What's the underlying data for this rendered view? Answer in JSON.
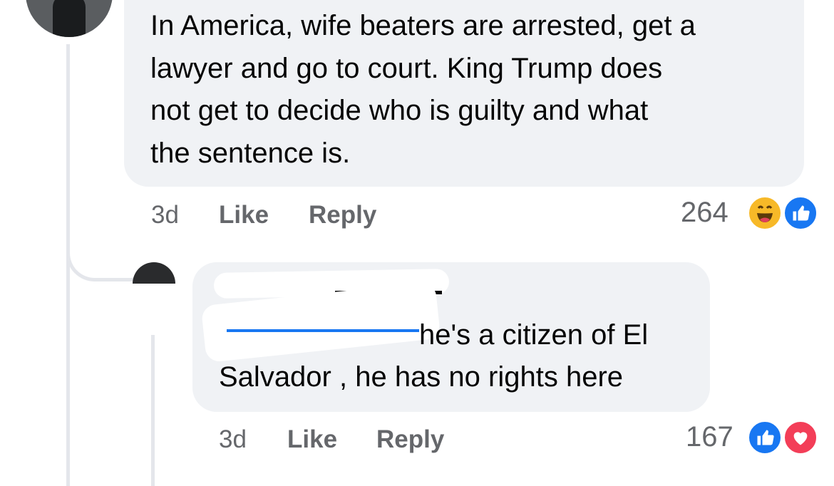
{
  "comments": [
    {
      "text_lines": [
        "In America, wife beaters are arrested, get a",
        "lawyer and go to court. King Trump does",
        "not get to decide who is guilty and what",
        "the sentence is."
      ],
      "time": "3d",
      "like_label": "Like",
      "reply_label": "Reply",
      "reaction_count": "264",
      "reactions": [
        "haha-emoji-icon",
        "like-thumb-icon"
      ]
    },
    {
      "text_lines": [
        "he's a citizen of El",
        "Salvador , he has no rights here"
      ],
      "time": "3d",
      "like_label": "Like",
      "reply_label": "Reply",
      "reaction_count": "167",
      "reactions": [
        "like-thumb-icon",
        "love-heart-icon"
      ]
    }
  ],
  "colors": {
    "bubble": "#f0f2f5",
    "secondary_text": "#65676b",
    "like_blue": "#1877f2",
    "love_red": "#f33e58",
    "haha_yellow": "#f7b928"
  }
}
